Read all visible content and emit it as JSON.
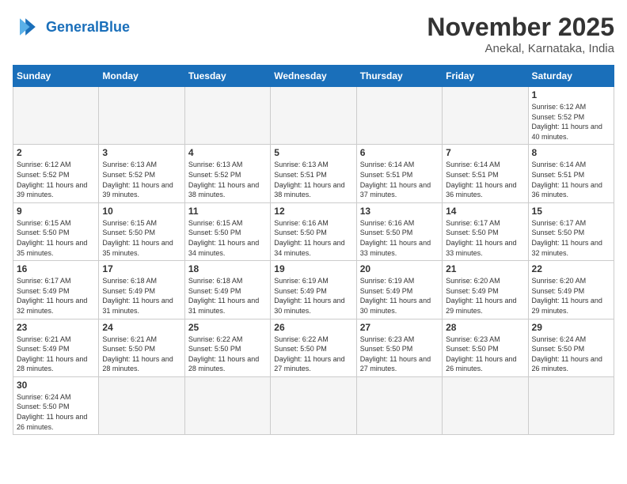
{
  "header": {
    "logo_general": "General",
    "logo_blue": "Blue",
    "month_title": "November 2025",
    "subtitle": "Anekal, Karnataka, India"
  },
  "weekdays": [
    "Sunday",
    "Monday",
    "Tuesday",
    "Wednesday",
    "Thursday",
    "Friday",
    "Saturday"
  ],
  "days": [
    {
      "date": null,
      "sunrise": null,
      "sunset": null,
      "daylight": null
    },
    {
      "date": null,
      "sunrise": null,
      "sunset": null,
      "daylight": null
    },
    {
      "date": null,
      "sunrise": null,
      "sunset": null,
      "daylight": null
    },
    {
      "date": null,
      "sunrise": null,
      "sunset": null,
      "daylight": null
    },
    {
      "date": null,
      "sunrise": null,
      "sunset": null,
      "daylight": null
    },
    {
      "date": null,
      "sunrise": null,
      "sunset": null,
      "daylight": null
    },
    {
      "date": "1",
      "sunrise": "6:12 AM",
      "sunset": "5:52 PM",
      "daylight": "11 hours and 40 minutes."
    },
    {
      "date": "2",
      "sunrise": "6:12 AM",
      "sunset": "5:52 PM",
      "daylight": "11 hours and 39 minutes."
    },
    {
      "date": "3",
      "sunrise": "6:13 AM",
      "sunset": "5:52 PM",
      "daylight": "11 hours and 39 minutes."
    },
    {
      "date": "4",
      "sunrise": "6:13 AM",
      "sunset": "5:52 PM",
      "daylight": "11 hours and 38 minutes."
    },
    {
      "date": "5",
      "sunrise": "6:13 AM",
      "sunset": "5:51 PM",
      "daylight": "11 hours and 38 minutes."
    },
    {
      "date": "6",
      "sunrise": "6:14 AM",
      "sunset": "5:51 PM",
      "daylight": "11 hours and 37 minutes."
    },
    {
      "date": "7",
      "sunrise": "6:14 AM",
      "sunset": "5:51 PM",
      "daylight": "11 hours and 36 minutes."
    },
    {
      "date": "8",
      "sunrise": "6:14 AM",
      "sunset": "5:51 PM",
      "daylight": "11 hours and 36 minutes."
    },
    {
      "date": "9",
      "sunrise": "6:15 AM",
      "sunset": "5:50 PM",
      "daylight": "11 hours and 35 minutes."
    },
    {
      "date": "10",
      "sunrise": "6:15 AM",
      "sunset": "5:50 PM",
      "daylight": "11 hours and 35 minutes."
    },
    {
      "date": "11",
      "sunrise": "6:15 AM",
      "sunset": "5:50 PM",
      "daylight": "11 hours and 34 minutes."
    },
    {
      "date": "12",
      "sunrise": "6:16 AM",
      "sunset": "5:50 PM",
      "daylight": "11 hours and 34 minutes."
    },
    {
      "date": "13",
      "sunrise": "6:16 AM",
      "sunset": "5:50 PM",
      "daylight": "11 hours and 33 minutes."
    },
    {
      "date": "14",
      "sunrise": "6:17 AM",
      "sunset": "5:50 PM",
      "daylight": "11 hours and 33 minutes."
    },
    {
      "date": "15",
      "sunrise": "6:17 AM",
      "sunset": "5:50 PM",
      "daylight": "11 hours and 32 minutes."
    },
    {
      "date": "16",
      "sunrise": "6:17 AM",
      "sunset": "5:49 PM",
      "daylight": "11 hours and 32 minutes."
    },
    {
      "date": "17",
      "sunrise": "6:18 AM",
      "sunset": "5:49 PM",
      "daylight": "11 hours and 31 minutes."
    },
    {
      "date": "18",
      "sunrise": "6:18 AM",
      "sunset": "5:49 PM",
      "daylight": "11 hours and 31 minutes."
    },
    {
      "date": "19",
      "sunrise": "6:19 AM",
      "sunset": "5:49 PM",
      "daylight": "11 hours and 30 minutes."
    },
    {
      "date": "20",
      "sunrise": "6:19 AM",
      "sunset": "5:49 PM",
      "daylight": "11 hours and 30 minutes."
    },
    {
      "date": "21",
      "sunrise": "6:20 AM",
      "sunset": "5:49 PM",
      "daylight": "11 hours and 29 minutes."
    },
    {
      "date": "22",
      "sunrise": "6:20 AM",
      "sunset": "5:49 PM",
      "daylight": "11 hours and 29 minutes."
    },
    {
      "date": "23",
      "sunrise": "6:21 AM",
      "sunset": "5:49 PM",
      "daylight": "11 hours and 28 minutes."
    },
    {
      "date": "24",
      "sunrise": "6:21 AM",
      "sunset": "5:50 PM",
      "daylight": "11 hours and 28 minutes."
    },
    {
      "date": "25",
      "sunrise": "6:22 AM",
      "sunset": "5:50 PM",
      "daylight": "11 hours and 28 minutes."
    },
    {
      "date": "26",
      "sunrise": "6:22 AM",
      "sunset": "5:50 PM",
      "daylight": "11 hours and 27 minutes."
    },
    {
      "date": "27",
      "sunrise": "6:23 AM",
      "sunset": "5:50 PM",
      "daylight": "11 hours and 27 minutes."
    },
    {
      "date": "28",
      "sunrise": "6:23 AM",
      "sunset": "5:50 PM",
      "daylight": "11 hours and 26 minutes."
    },
    {
      "date": "29",
      "sunrise": "6:24 AM",
      "sunset": "5:50 PM",
      "daylight": "11 hours and 26 minutes."
    },
    {
      "date": "30",
      "sunrise": "6:24 AM",
      "sunset": "5:50 PM",
      "daylight": "11 hours and 26 minutes."
    },
    {
      "date": null
    },
    {
      "date": null
    },
    {
      "date": null
    },
    {
      "date": null
    },
    {
      "date": null
    },
    {
      "date": null
    }
  ]
}
